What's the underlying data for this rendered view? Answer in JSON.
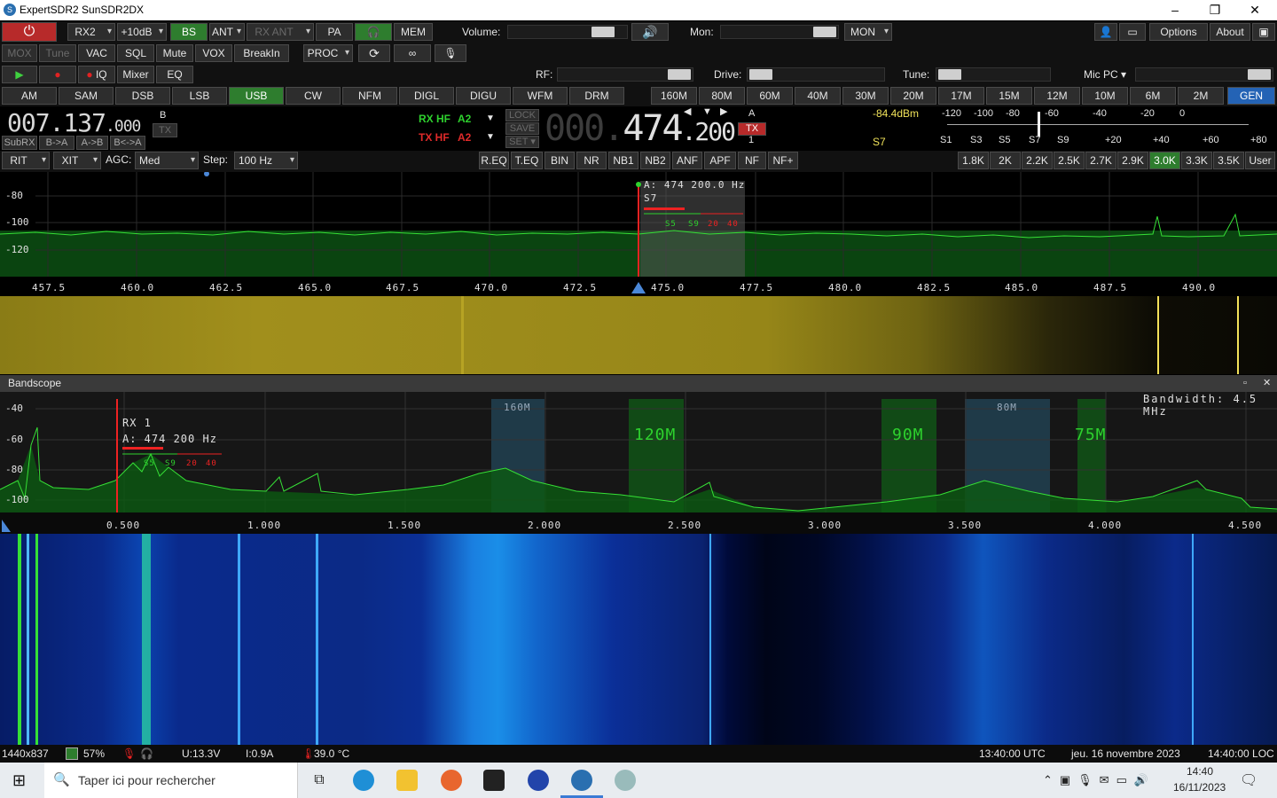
{
  "window": {
    "title": "ExpertSDR2 SunSDR2DX",
    "app_icon": "sdr-app-icon",
    "min": "–",
    "max": "❐",
    "close": "✕"
  },
  "row1": {
    "rx2": "RX2",
    "gain": "+10dB",
    "bs": "BS",
    "ant": "ANT",
    "rxant": "RX ANT",
    "pa": "PA",
    "mem": "MEM",
    "volume_label": "Volume:",
    "mon_label": "Mon:",
    "mon": "MON",
    "options": "Options",
    "about": "About",
    "volume_level": 0.8,
    "mon_level": 0.8
  },
  "row2": {
    "mox": "MOX",
    "tune": "Tune",
    "vac": "VAC",
    "sql": "SQL",
    "mute": "Mute",
    "vox": "VOX",
    "breakin": "BreakIn",
    "proc": "PROC"
  },
  "row3": {
    "iq": "IQ",
    "mixer": "Mixer",
    "eq": "EQ",
    "rf_label": "RF:",
    "drive_label": "Drive:",
    "tune_label": "Tune:",
    "micpc": "Mic PC"
  },
  "modes": [
    "AM",
    "SAM",
    "DSB",
    "LSB",
    "USB",
    "CW",
    "NFM",
    "DIGL",
    "DIGU",
    "WFM",
    "DRM"
  ],
  "active_mode": "USB",
  "bands": [
    "160M",
    "80M",
    "60M",
    "40M",
    "30M",
    "20M",
    "17M",
    "15M",
    "12M",
    "10M",
    "6M",
    "2M",
    "GEN"
  ],
  "active_band": "GEN",
  "vfo": {
    "b_freq_main": "007.137",
    "b_freq_sub": ".000",
    "b_label": "B",
    "tx_small": "TX",
    "subrx": "SubRX",
    "b_to_a": "B->A",
    "a_to_b": "A->B",
    "swap": "B<->A",
    "rxhf": "RX HF",
    "rxant": "A2",
    "txhf": "TX HF",
    "txant": "A2",
    "lock": "LOCK",
    "save": "SAVE",
    "set": "SET",
    "a_freq_dim": "000.",
    "a_freq_main": "474",
    "a_freq_sub": ".200",
    "a_label": "A",
    "tx_badge": "TX",
    "tx_num": "1"
  },
  "smeter": {
    "dbm": "-84.4dBm",
    "scale_top": [
      "-120",
      "-100",
      "-80",
      "-60",
      "-40",
      "-20",
      "0"
    ],
    "s_reading": "S7",
    "scale_bottom": [
      "S1",
      "S3",
      "S5",
      "S7",
      "S9",
      "+20",
      "+40",
      "+60",
      "+80"
    ]
  },
  "row5": {
    "rit": "RIT",
    "xit": "XIT",
    "agc_label": "AGC:",
    "agc": "Med",
    "step_label": "Step:",
    "step": "100 Hz",
    "dsp": [
      "R.EQ",
      "T.EQ",
      "BIN",
      "NR",
      "NB1",
      "NB2",
      "ANF",
      "APF",
      "NF",
      "NF+"
    ],
    "filters": [
      "1.8K",
      "2K",
      "2.2K",
      "2.5K",
      "2.7K",
      "2.9K",
      "3.0K",
      "3.3K",
      "3.5K",
      "User"
    ],
    "active_filter": "3.0K"
  },
  "panadapter": {
    "ylabels": [
      "-80",
      "-100",
      "-120"
    ],
    "xlabels": [
      "457.5",
      "460.0",
      "462.5",
      "465.0",
      "467.5",
      "470.0",
      "472.5",
      "475.0",
      "477.5",
      "480.0",
      "482.5",
      "485.0",
      "487.5",
      "490.0"
    ],
    "marker": "A: 474 200.0 Hz",
    "smeter": "S7",
    "scale_green": [
      "S5",
      "S9"
    ],
    "scale_red": [
      "20",
      "40"
    ]
  },
  "bandscope": {
    "title": "Bandscope",
    "bandwidth": "Bandwidth: 4.5 MHz",
    "ylabels": [
      "-40",
      "-60",
      "-80",
      "-100"
    ],
    "xlabels": [
      "0.500",
      "1.000",
      "1.500",
      "2.000",
      "2.500",
      "3.000",
      "3.500",
      "4.000",
      "4.500"
    ],
    "bands": [
      "160M",
      "120M",
      "90M",
      "80M",
      "75M"
    ],
    "rx": "RX 1",
    "marker": "A: 474 200 Hz",
    "scale_green": [
      "S5",
      "S9"
    ],
    "scale_red": [
      "20",
      "40"
    ]
  },
  "status": {
    "resolution": "1440x837",
    "cpu": "57%",
    "voltage": "U:13.3V",
    "current": "I:0.9A",
    "temp": "39.0 °C",
    "utc": "13:40:00 UTC",
    "date": "jeu. 16 novembre 2023",
    "loc": "14:40:00 LOC"
  },
  "taskbar": {
    "search_placeholder": "Taper ici pour rechercher",
    "time": "14:40",
    "date": "16/11/2023"
  }
}
